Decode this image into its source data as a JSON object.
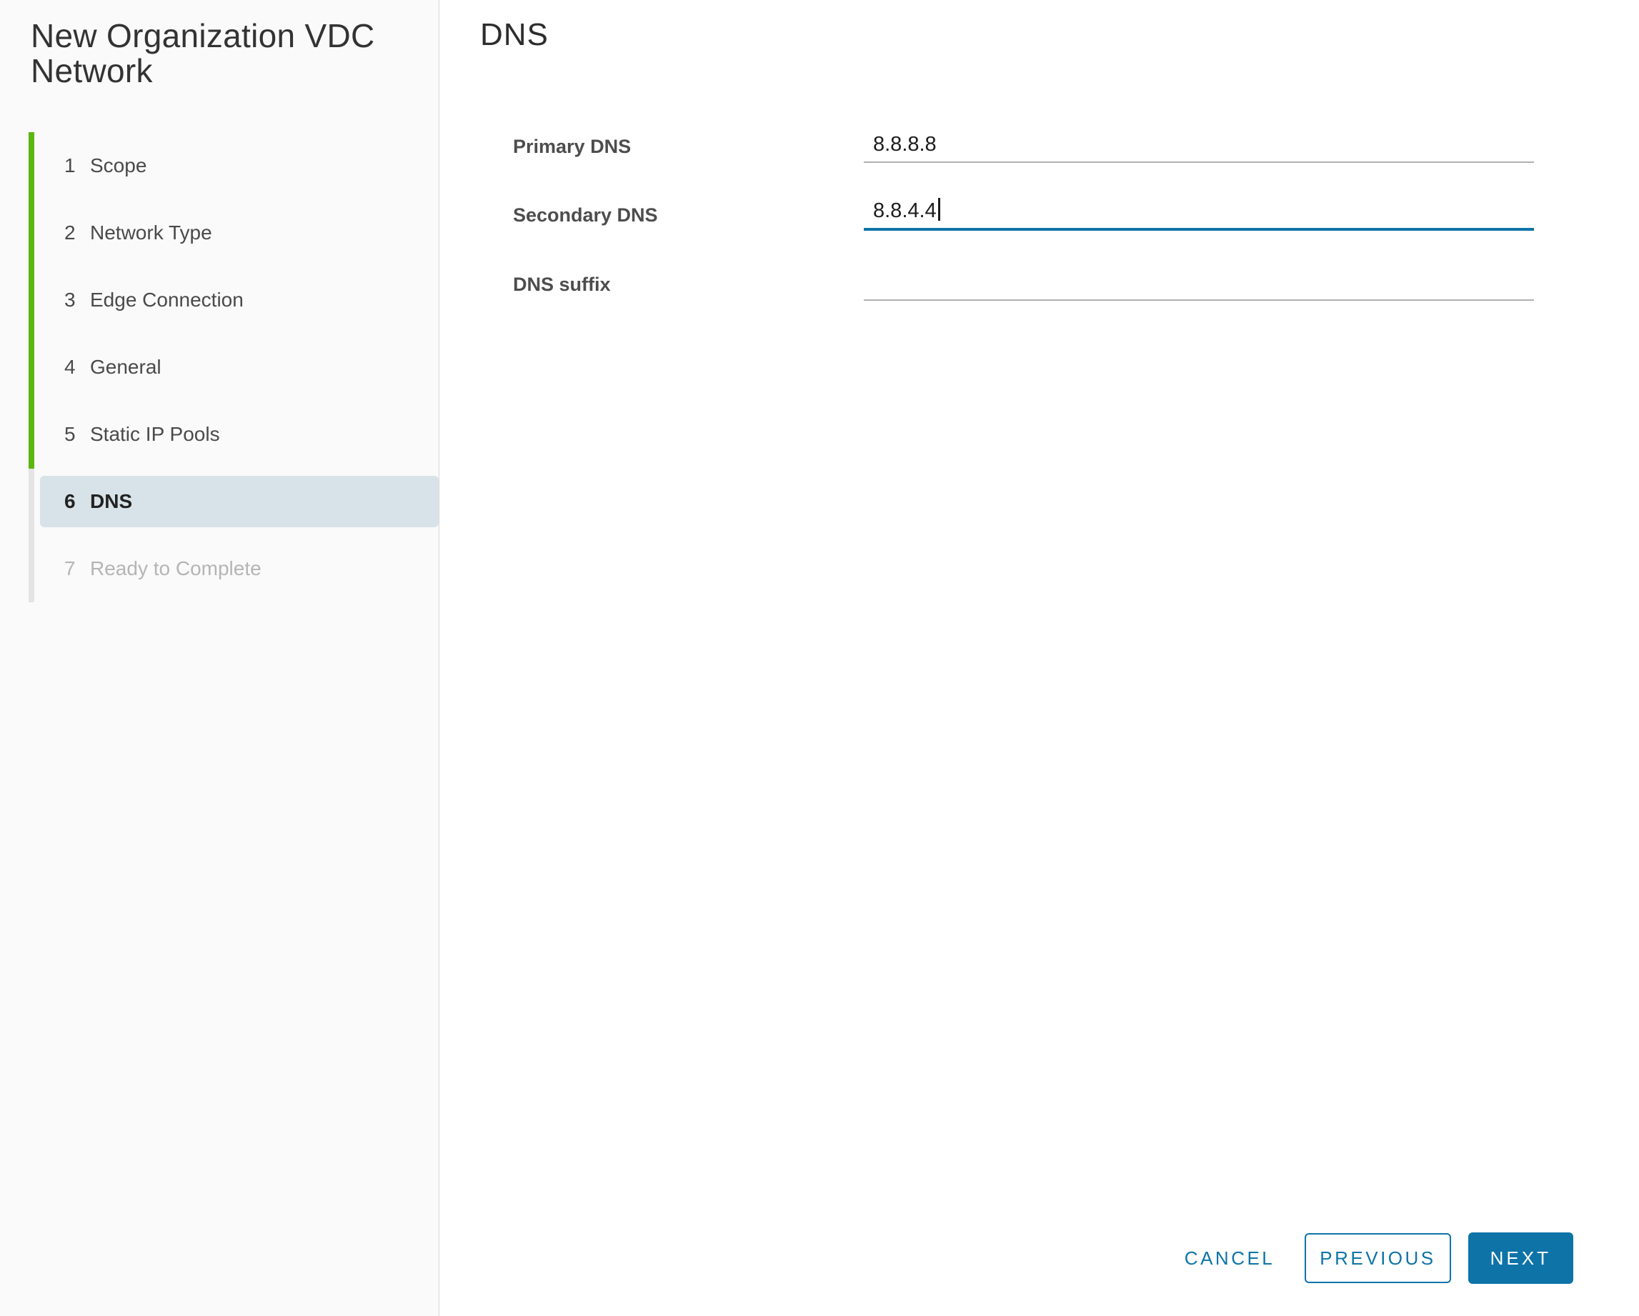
{
  "wizard": {
    "title": "New Organization VDC Network",
    "steps": [
      {
        "number": "1",
        "label": "Scope",
        "state": "completed"
      },
      {
        "number": "2",
        "label": "Network Type",
        "state": "completed"
      },
      {
        "number": "3",
        "label": "Edge Connection",
        "state": "completed"
      },
      {
        "number": "4",
        "label": "General",
        "state": "completed"
      },
      {
        "number": "5",
        "label": "Static IP Pools",
        "state": "completed"
      },
      {
        "number": "6",
        "label": "DNS",
        "state": "current"
      },
      {
        "number": "7",
        "label": "Ready to Complete",
        "state": "disabled"
      }
    ]
  },
  "panel": {
    "heading": "DNS",
    "fields": [
      {
        "label": "Primary DNS",
        "value": "8.8.8.8",
        "state": "filled"
      },
      {
        "label": "Secondary DNS",
        "value": "8.8.4.4",
        "state": "focused"
      },
      {
        "label": "DNS suffix",
        "value": "",
        "state": "empty"
      }
    ]
  },
  "footer": {
    "cancel_label": "CANCEL",
    "previous_label": "PREVIOUS",
    "next_label": "NEXT"
  },
  "colors": {
    "accent_blue": "#0e74a8",
    "progress_green": "#5cb613",
    "remaining_track_gray": "#e4e4e4",
    "selected_step_bg": "#d8e3e9",
    "sidebar_bg": "#fafafa",
    "underline_gray": "#b0b0b0"
  }
}
